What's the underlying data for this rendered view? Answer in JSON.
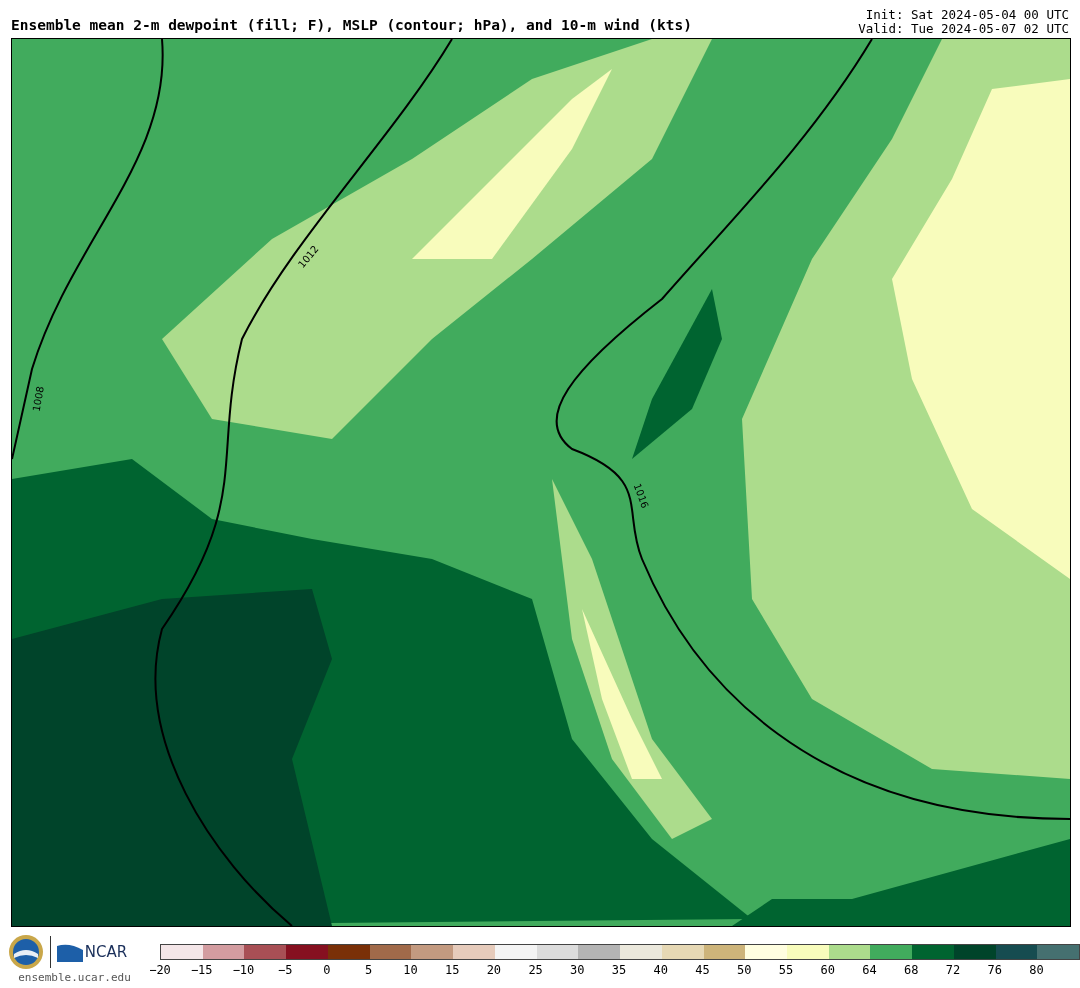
{
  "header": {
    "title": "Ensemble mean 2-m dewpoint (fill; F), MSLP (contour; hPa), and 10-m wind (kts)",
    "init": "Init: Sat 2024-05-04 00 UTC",
    "valid": "Valid: Tue 2024-05-07 02 UTC"
  },
  "map": {
    "contour_labels": [
      {
        "text": "1008"
      },
      {
        "text": "1012"
      },
      {
        "text": "1016"
      }
    ]
  },
  "footer": {
    "logo_text": "NCAR",
    "url": "ensemble.ucar.edu"
  },
  "colorbar": {
    "segments": [
      {
        "color": "#f4e6e8",
        "label": "−20"
      },
      {
        "color": "#d39ca0",
        "label": "−15"
      },
      {
        "color": "#a84f55",
        "label": "−10"
      },
      {
        "color": "#861020",
        "label": "−5"
      },
      {
        "color": "#7a3008",
        "label": "0"
      },
      {
        "color": "#a16a4a",
        "label": "5"
      },
      {
        "color": "#c39a80",
        "label": "10"
      },
      {
        "color": "#e6cbbb",
        "label": "15"
      },
      {
        "color": "#f4f4f4",
        "label": "20"
      },
      {
        "color": "#dcdcdc",
        "label": "25"
      },
      {
        "color": "#b4b4b4",
        "label": "30"
      },
      {
        "color": "#ebe8dc",
        "label": "35"
      },
      {
        "color": "#e6d8b4",
        "label": "40"
      },
      {
        "color": "#cdb47a",
        "label": "45"
      },
      {
        "color": "#fffee0",
        "label": "50"
      },
      {
        "color": "#f8fcbc",
        "label": "55"
      },
      {
        "color": "#acdc8c",
        "label": "60"
      },
      {
        "color": "#41ab5d",
        "label": "64"
      },
      {
        "color": "#006430",
        "label": "68"
      },
      {
        "color": "#00442a",
        "label": "72"
      },
      {
        "color": "#164c50",
        "label": "76"
      },
      {
        "color": "#457070",
        "label": "80"
      }
    ]
  }
}
